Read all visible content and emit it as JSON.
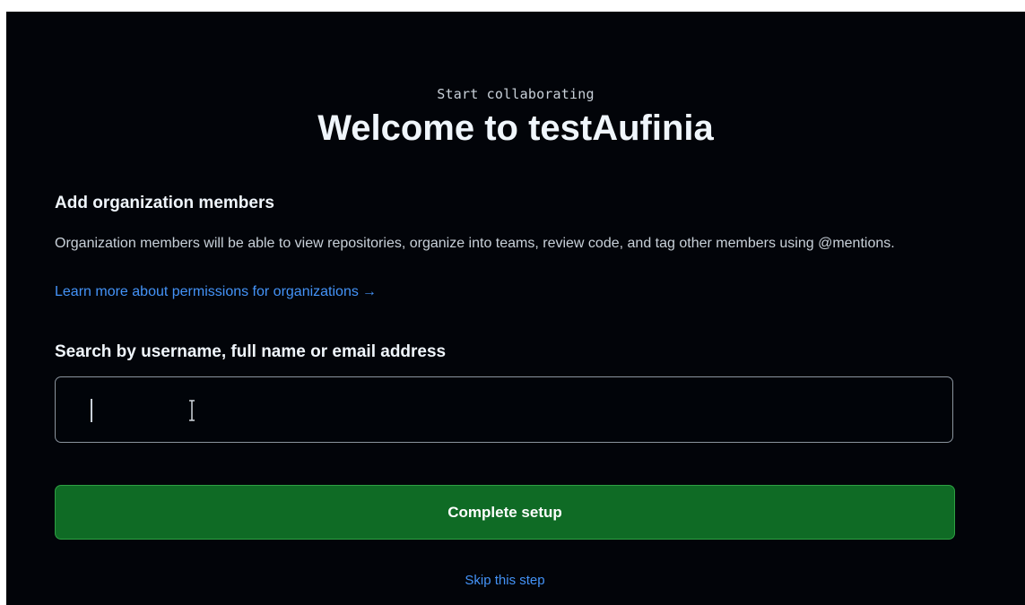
{
  "header": {
    "eyebrow": "Start collaborating",
    "title": "Welcome to testAufinia"
  },
  "members": {
    "heading": "Add organization members",
    "description": "Organization members will be able to view repositories, organize into teams, review code, and tag other members using @mentions.",
    "learn_more_link": "Learn more about permissions for organizations",
    "learn_more_arrow": "→"
  },
  "search": {
    "label": "Search by username, full name or email address",
    "value": "",
    "placeholder": ""
  },
  "actions": {
    "complete_label": "Complete setup",
    "skip_label": "Skip this step"
  },
  "colors": {
    "background": "#020409",
    "accent_link": "#4493f8",
    "primary_button": "#0f6b25"
  },
  "icons": {
    "cursor": "text-cursor-ibeam-icon"
  }
}
